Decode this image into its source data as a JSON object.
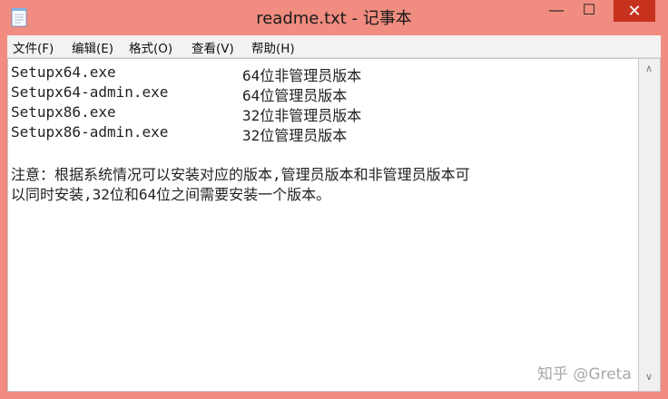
{
  "window": {
    "title": "readme.txt - 记事本"
  },
  "controls": {
    "minimize": "—",
    "maximize": "☐",
    "close": "✕"
  },
  "menu": [
    "文件(F)",
    "编辑(E)",
    "格式(O)",
    "查看(V)",
    "帮助(H)"
  ],
  "content": {
    "rows": [
      {
        "file": "Setupx64.exe",
        "desc": "64位非管理员版本"
      },
      {
        "file": "Setupx64-admin.exe",
        "desc": "64位管理员版本"
      },
      {
        "file": "Setupx86.exe",
        "desc": "32位非管理员版本"
      },
      {
        "file": "Setupx86-admin.exe",
        "desc": "32位管理员版本"
      }
    ],
    "note_line1": "注意：根据系统情况可以安装对应的版本,管理员版本和非管理员版本可",
    "note_line2": "以同时安装,32位和64位之间需要安装一个版本。"
  },
  "scrollbar": {
    "up": "∧",
    "down": "∨"
  },
  "watermark": "知乎 @Greta"
}
